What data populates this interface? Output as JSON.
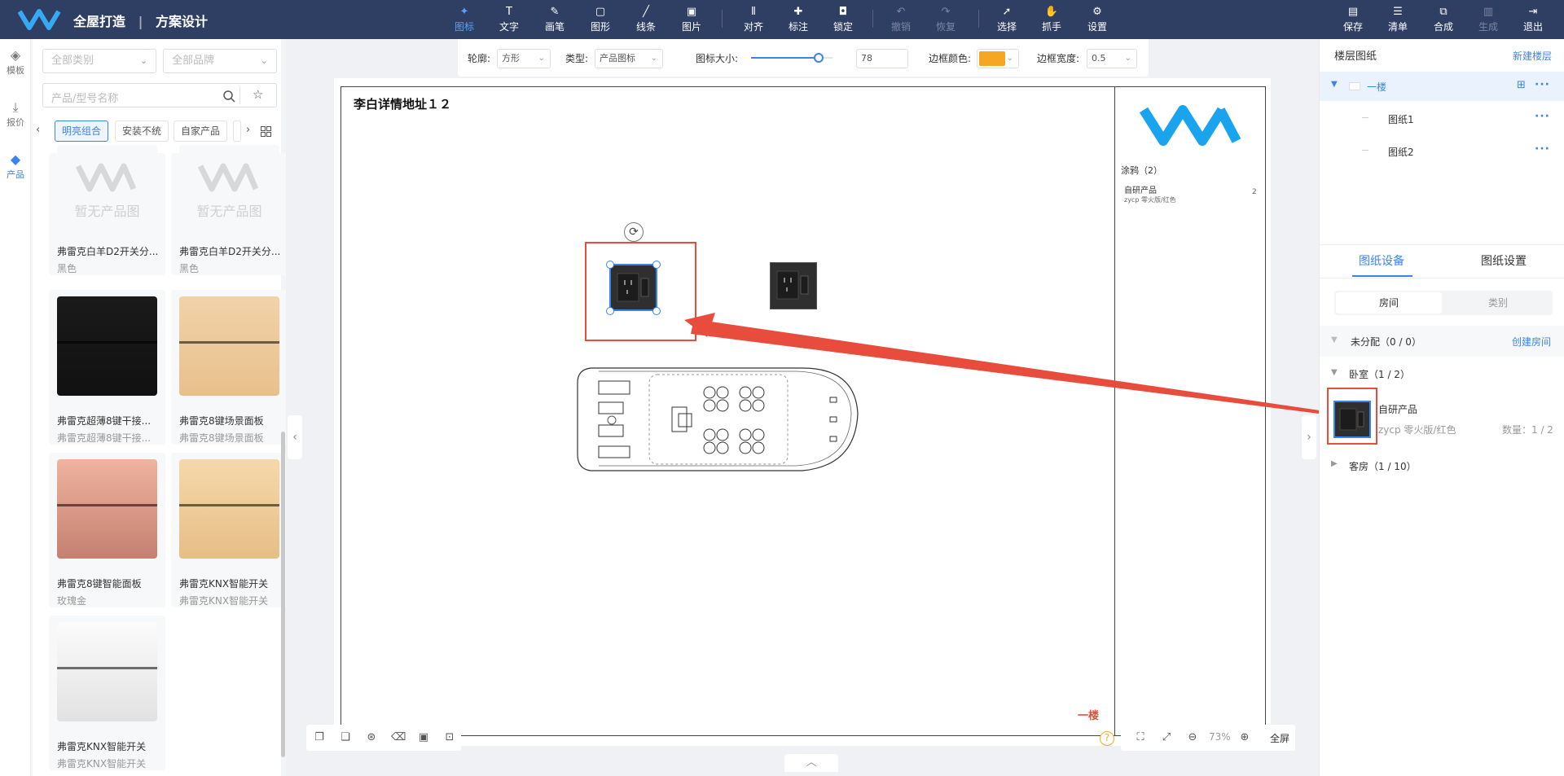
{
  "app": {
    "title": "全屋打造",
    "subtitle": "方案设计",
    "separator": "|"
  },
  "colors": {
    "topbar": "#2f3e63",
    "accent": "#3a84f0",
    "highlight": "#e74c3c",
    "border_color": "#f5a623"
  },
  "toolbar": {
    "tools": [
      {
        "label": "图标",
        "icon": "pointer-shape-icon",
        "glyph": "✦"
      },
      {
        "label": "文字",
        "icon": "text-icon",
        "glyph": "T"
      },
      {
        "label": "画笔",
        "icon": "brush-icon",
        "glyph": "✎"
      },
      {
        "label": "图形",
        "icon": "shape-icon",
        "glyph": "▢"
      },
      {
        "label": "线条",
        "icon": "line-icon",
        "glyph": "╱"
      },
      {
        "label": "图片",
        "icon": "image-icon",
        "glyph": "▣"
      },
      {
        "label": "对齐",
        "icon": "align-icon",
        "glyph": "⫴"
      },
      {
        "label": "标注",
        "icon": "pin-icon",
        "glyph": "✚"
      },
      {
        "label": "锁定",
        "icon": "lock-icon",
        "glyph": "◘"
      },
      {
        "label": "撤销",
        "icon": "undo-icon",
        "glyph": "↶"
      },
      {
        "label": "恢复",
        "icon": "redo-icon",
        "glyph": "↷"
      },
      {
        "label": "选择",
        "icon": "select-icon",
        "glyph": "➚"
      },
      {
        "label": "抓手",
        "icon": "hand-icon",
        "glyph": "✋"
      },
      {
        "label": "设置",
        "icon": "gear-icon",
        "glyph": "⚙"
      }
    ],
    "right_tools": [
      {
        "label": "保存",
        "icon": "save-icon",
        "glyph": "▤"
      },
      {
        "label": "清单",
        "icon": "list-icon",
        "glyph": "☰"
      },
      {
        "label": "合成",
        "icon": "compose-icon",
        "glyph": "⧉"
      },
      {
        "label": "生成",
        "icon": "generate-icon",
        "glyph": "▥"
      },
      {
        "label": "退出",
        "icon": "exit-icon",
        "glyph": "⇥"
      }
    ]
  },
  "left_rail": [
    {
      "label": "模板",
      "icon": "layers-icon",
      "glyph": "◈"
    },
    {
      "label": "报价",
      "icon": "download-icon",
      "glyph": "⤓"
    },
    {
      "label": "产品",
      "icon": "cube-icon",
      "glyph": "◆"
    }
  ],
  "filters": {
    "category_placeholder": "全部类别",
    "brand_placeholder": "全部品牌",
    "search_placeholder": "产品/型号名称"
  },
  "chips": [
    "明亮组合",
    "安装不统",
    "自家产品"
  ],
  "products": [
    {
      "name": "弗雷克白羊D2开关分...",
      "sub": "黑色",
      "placeholder": "暂无产品图"
    },
    {
      "name": "弗雷克白羊D2开关分...",
      "sub": "黑色",
      "placeholder": "暂无产品图"
    },
    {
      "name": "弗雷克超薄8键干接...",
      "sub": "弗雷克超薄8键干接..."
    },
    {
      "name": "弗雷克8键场景面板",
      "sub": "弗雷克8键场景面板"
    },
    {
      "name": "弗雷克8键智能面板",
      "sub": "玫瑰金"
    },
    {
      "name": "弗雷克KNX智能开关",
      "sub": "弗雷克KNX智能开关"
    },
    {
      "name": "弗雷克KNX智能开关",
      "sub": "弗雷克KNX智能开关"
    }
  ],
  "properties": {
    "outline_label": "轮廓:",
    "outline_value": "方形",
    "type_label": "类型:",
    "type_value": "产品图标",
    "size_label": "图标大小:",
    "size_value": "78",
    "size_slider_fraction": 0.83,
    "border_color_label": "边框颜色:",
    "border_width_label": "边框宽度:",
    "border_width_value": "0.5"
  },
  "canvas": {
    "address_title": "李白详情地址１２",
    "floor_label": "一楼",
    "legend": {
      "title": "涂鸦（2）",
      "item_name": "自研产品",
      "item_sub": "zycp 零火版/红色",
      "item_count": "2"
    }
  },
  "bottom_left_tools": [
    "copy-icon",
    "duplicate-icon",
    "group-icon",
    "delete-icon",
    "bring-front-icon",
    "fit-icon"
  ],
  "zoom": {
    "value": "73%",
    "fullscreen_label": "全屏"
  },
  "right_panel": {
    "title": "楼层图纸",
    "new_floor": "新建楼层",
    "floors": [
      {
        "label": "一楼",
        "sheets": [
          "图纸1",
          "图纸2"
        ]
      }
    ],
    "tabs": [
      "图纸设备",
      "图纸设置"
    ],
    "segments": [
      "房间",
      "类别"
    ],
    "groups": [
      {
        "label": "未分配（0 / 0）",
        "action": "创建房间"
      },
      {
        "label": "卧室（1 / 2）"
      },
      {
        "label": "客房（1 / 10）"
      }
    ],
    "device": {
      "name": "自研产品",
      "sub": "zycp 零火版/红色",
      "qty": "数量：1 / 2"
    }
  }
}
